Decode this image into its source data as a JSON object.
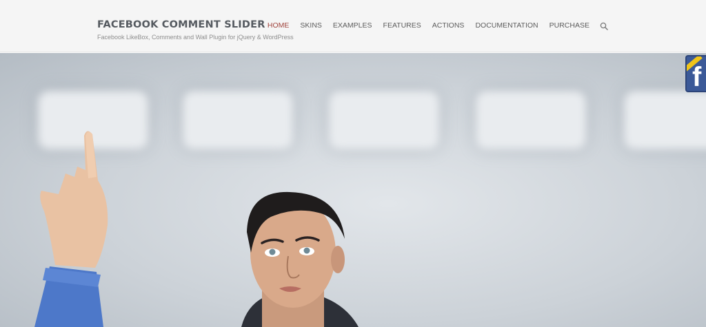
{
  "header": {
    "site_title": "FACEBOOK COMMENT SLIDER",
    "tagline": "Facebook LikeBox, Comments and Wall Plugin for jQuery & WordPress"
  },
  "nav": {
    "items": [
      {
        "label": "HOME",
        "active": true
      },
      {
        "label": "SKINS",
        "active": false
      },
      {
        "label": "EXAMPLES",
        "active": false
      },
      {
        "label": "FEATURES",
        "active": false
      },
      {
        "label": "ACTIONS",
        "active": false
      },
      {
        "label": "DOCUMENTATION",
        "active": false
      },
      {
        "label": "PURCHASE",
        "active": false
      }
    ],
    "search_icon": "search-icon"
  },
  "fb_badge": {
    "letter": "f",
    "icon": "facebook-icon"
  },
  "colors": {
    "header_bg": "#f5f5f5",
    "nav_text": "#5c5c5c",
    "nav_active": "#a1453e",
    "title": "#555a60",
    "facebook_blue": "#3b5998"
  }
}
